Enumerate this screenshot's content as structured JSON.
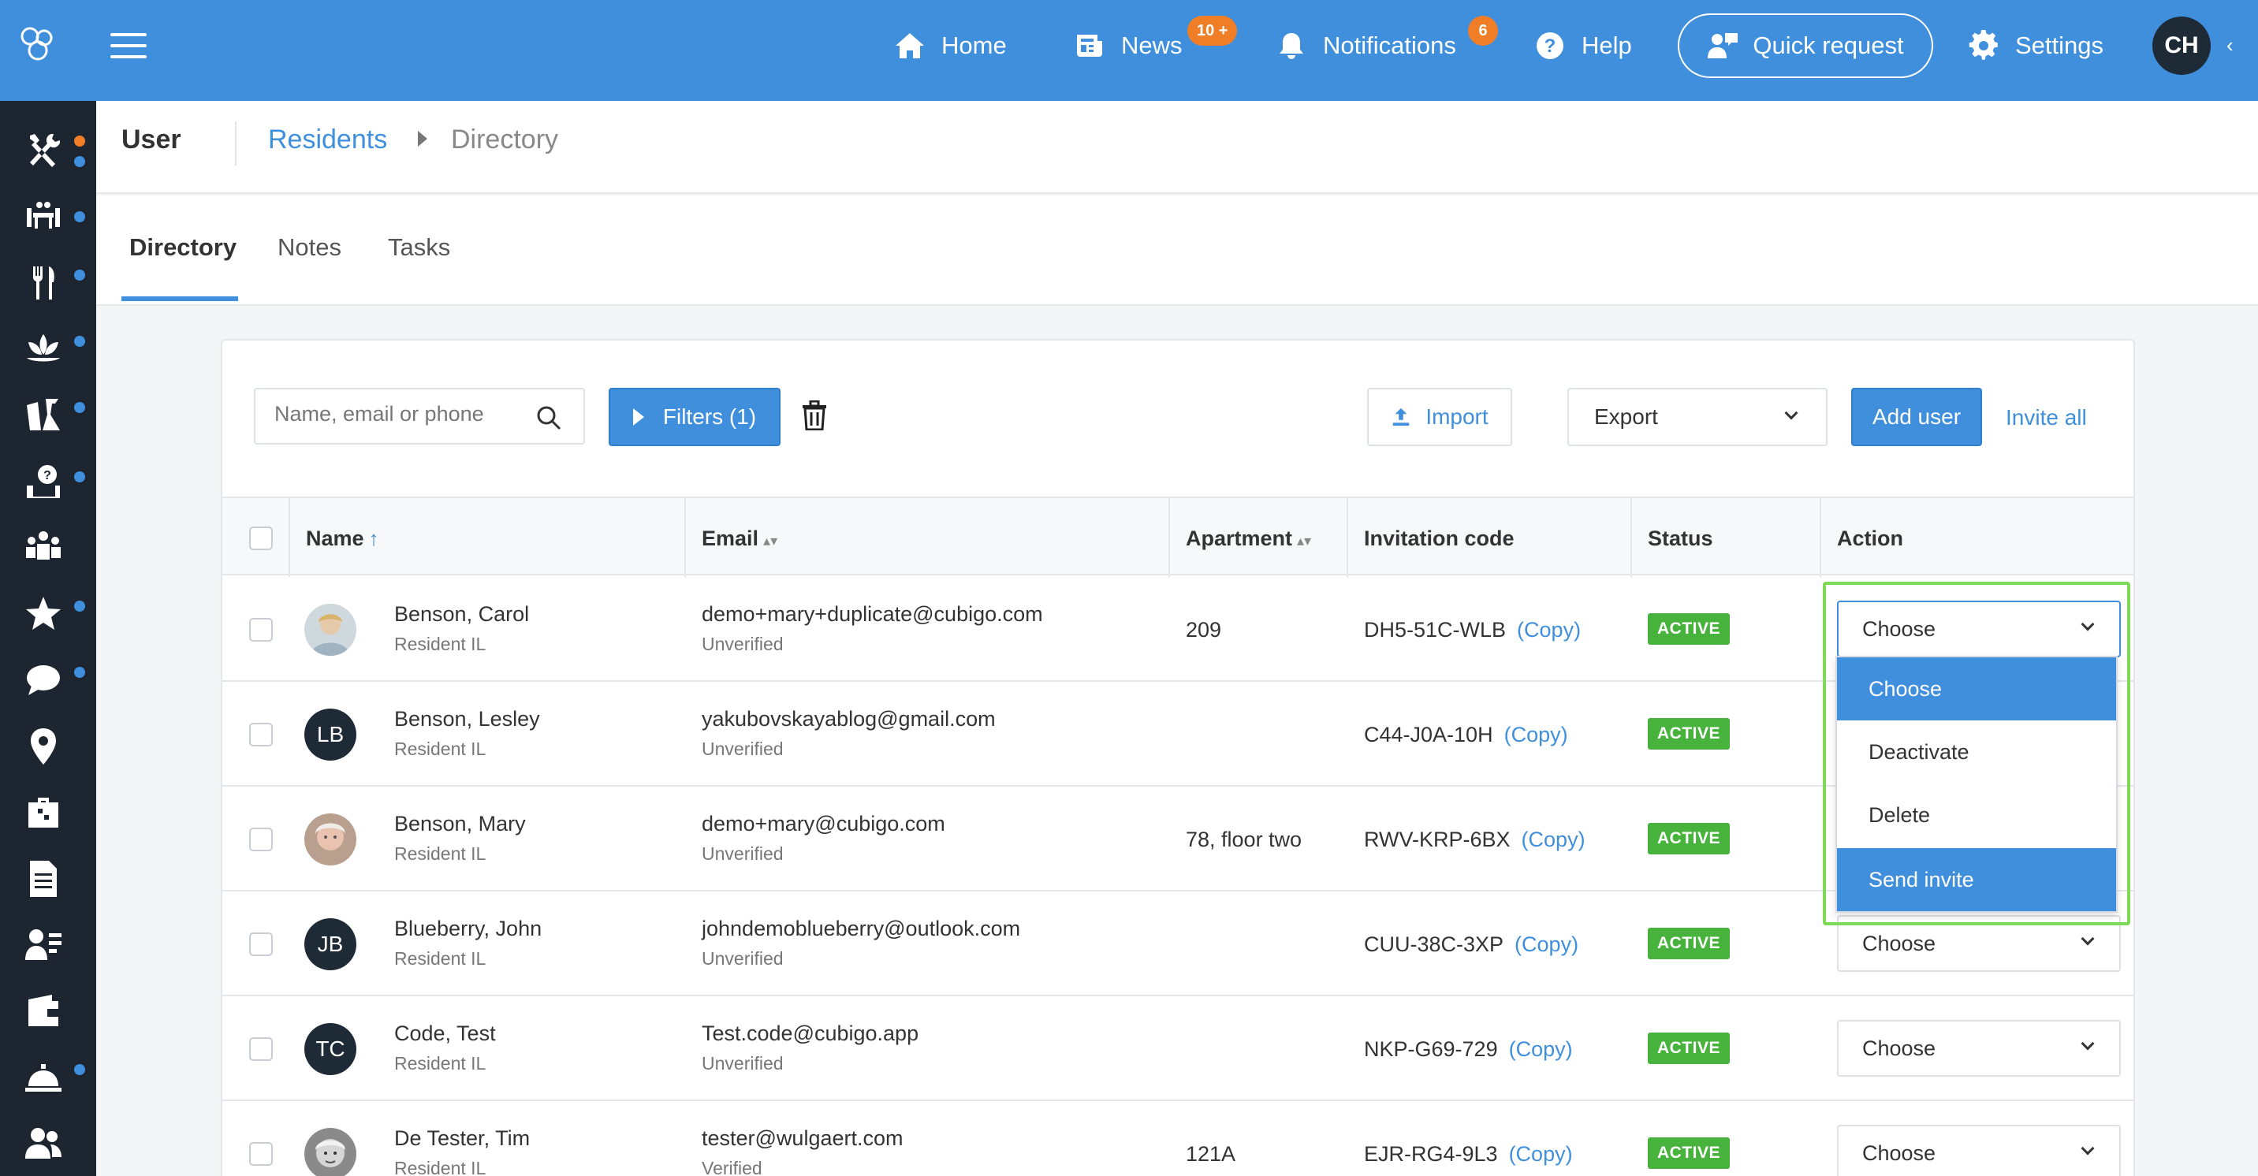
{
  "topbar": {
    "nav": [
      {
        "label": "Home",
        "icon": "home-icon"
      },
      {
        "label": "News",
        "icon": "newspaper-icon",
        "badge": "10 +"
      },
      {
        "label": "Notifications",
        "icon": "bell-icon",
        "badge": "6"
      },
      {
        "label": "Help",
        "icon": "help-icon"
      }
    ],
    "quick_request": "Quick request",
    "settings": "Settings",
    "user_initials": "CH",
    "accent": "#3f8fdc",
    "badge_color": "#f07e27"
  },
  "sidebar": {
    "items": [
      "tools-icon",
      "dining-icon",
      "cutlery-icon",
      "lotus-icon",
      "cleaning-icon",
      "laundry-icon",
      "group-icon",
      "star-icon",
      "chat-icon",
      "location-icon",
      "suitcase-icon",
      "document-icon",
      "user-list-icon",
      "wallet-icon",
      "service-bell-icon",
      "users-icon"
    ]
  },
  "breadcrumb": {
    "section": "User",
    "parent": "Residents",
    "current": "Directory"
  },
  "tabs": [
    "Directory",
    "Notes",
    "Tasks"
  ],
  "toolbar": {
    "search_placeholder": "Name, email or phone",
    "filters": "Filters (1)",
    "import": "Import",
    "export": "Export",
    "add_user": "Add user",
    "invite_all": "Invite all"
  },
  "table": {
    "columns": [
      "Name",
      "Email",
      "Apartment",
      "Invitation code",
      "Status",
      "Action"
    ],
    "copy_label": "(Copy)",
    "rows": [
      {
        "name": "Benson, Carol",
        "role": "Resident IL",
        "email": "demo+mary+duplicate@cubigo.com",
        "verification": "Unverified",
        "apartment": "209",
        "code": "DH5-51C-WLB",
        "status": "ACTIVE",
        "action": "Choose",
        "initials": ""
      },
      {
        "name": "Benson, Lesley",
        "role": "Resident IL",
        "email": "yakubovskayablog@gmail.com",
        "verification": "Unverified",
        "apartment": "",
        "code": "C44-J0A-10H",
        "status": "ACTIVE",
        "action": "Choose",
        "initials": "LB"
      },
      {
        "name": "Benson, Mary",
        "role": "Resident IL",
        "email": "demo+mary@cubigo.com",
        "verification": "Unverified",
        "apartment": "78, floor two",
        "code": "RWV-KRP-6BX",
        "status": "ACTIVE",
        "action": "Choose",
        "initials": ""
      },
      {
        "name": "Blueberry, John",
        "role": "Resident IL",
        "email": "johndemoblueberry@outlook.com",
        "verification": "Unverified",
        "apartment": "",
        "code": "CUU-38C-3XP",
        "status": "ACTIVE",
        "action": "Choose",
        "initials": "JB"
      },
      {
        "name": "Code, Test",
        "role": "Resident IL",
        "email": "Test.code@cubigo.app",
        "verification": "Unverified",
        "apartment": "",
        "code": "NKP-G69-729",
        "status": "ACTIVE",
        "action": "Choose",
        "initials": "TC"
      },
      {
        "name": "De Tester, Tim",
        "role": "Resident IL",
        "email": "tester@wulgaert.com",
        "verification": "Verified",
        "apartment": "121A",
        "code": "EJR-RG4-9L3",
        "status": "ACTIVE",
        "action": "Choose",
        "initials": ""
      }
    ]
  },
  "dropdown": {
    "options": [
      "Choose",
      "Deactivate",
      "Delete",
      "Send invite"
    ]
  }
}
